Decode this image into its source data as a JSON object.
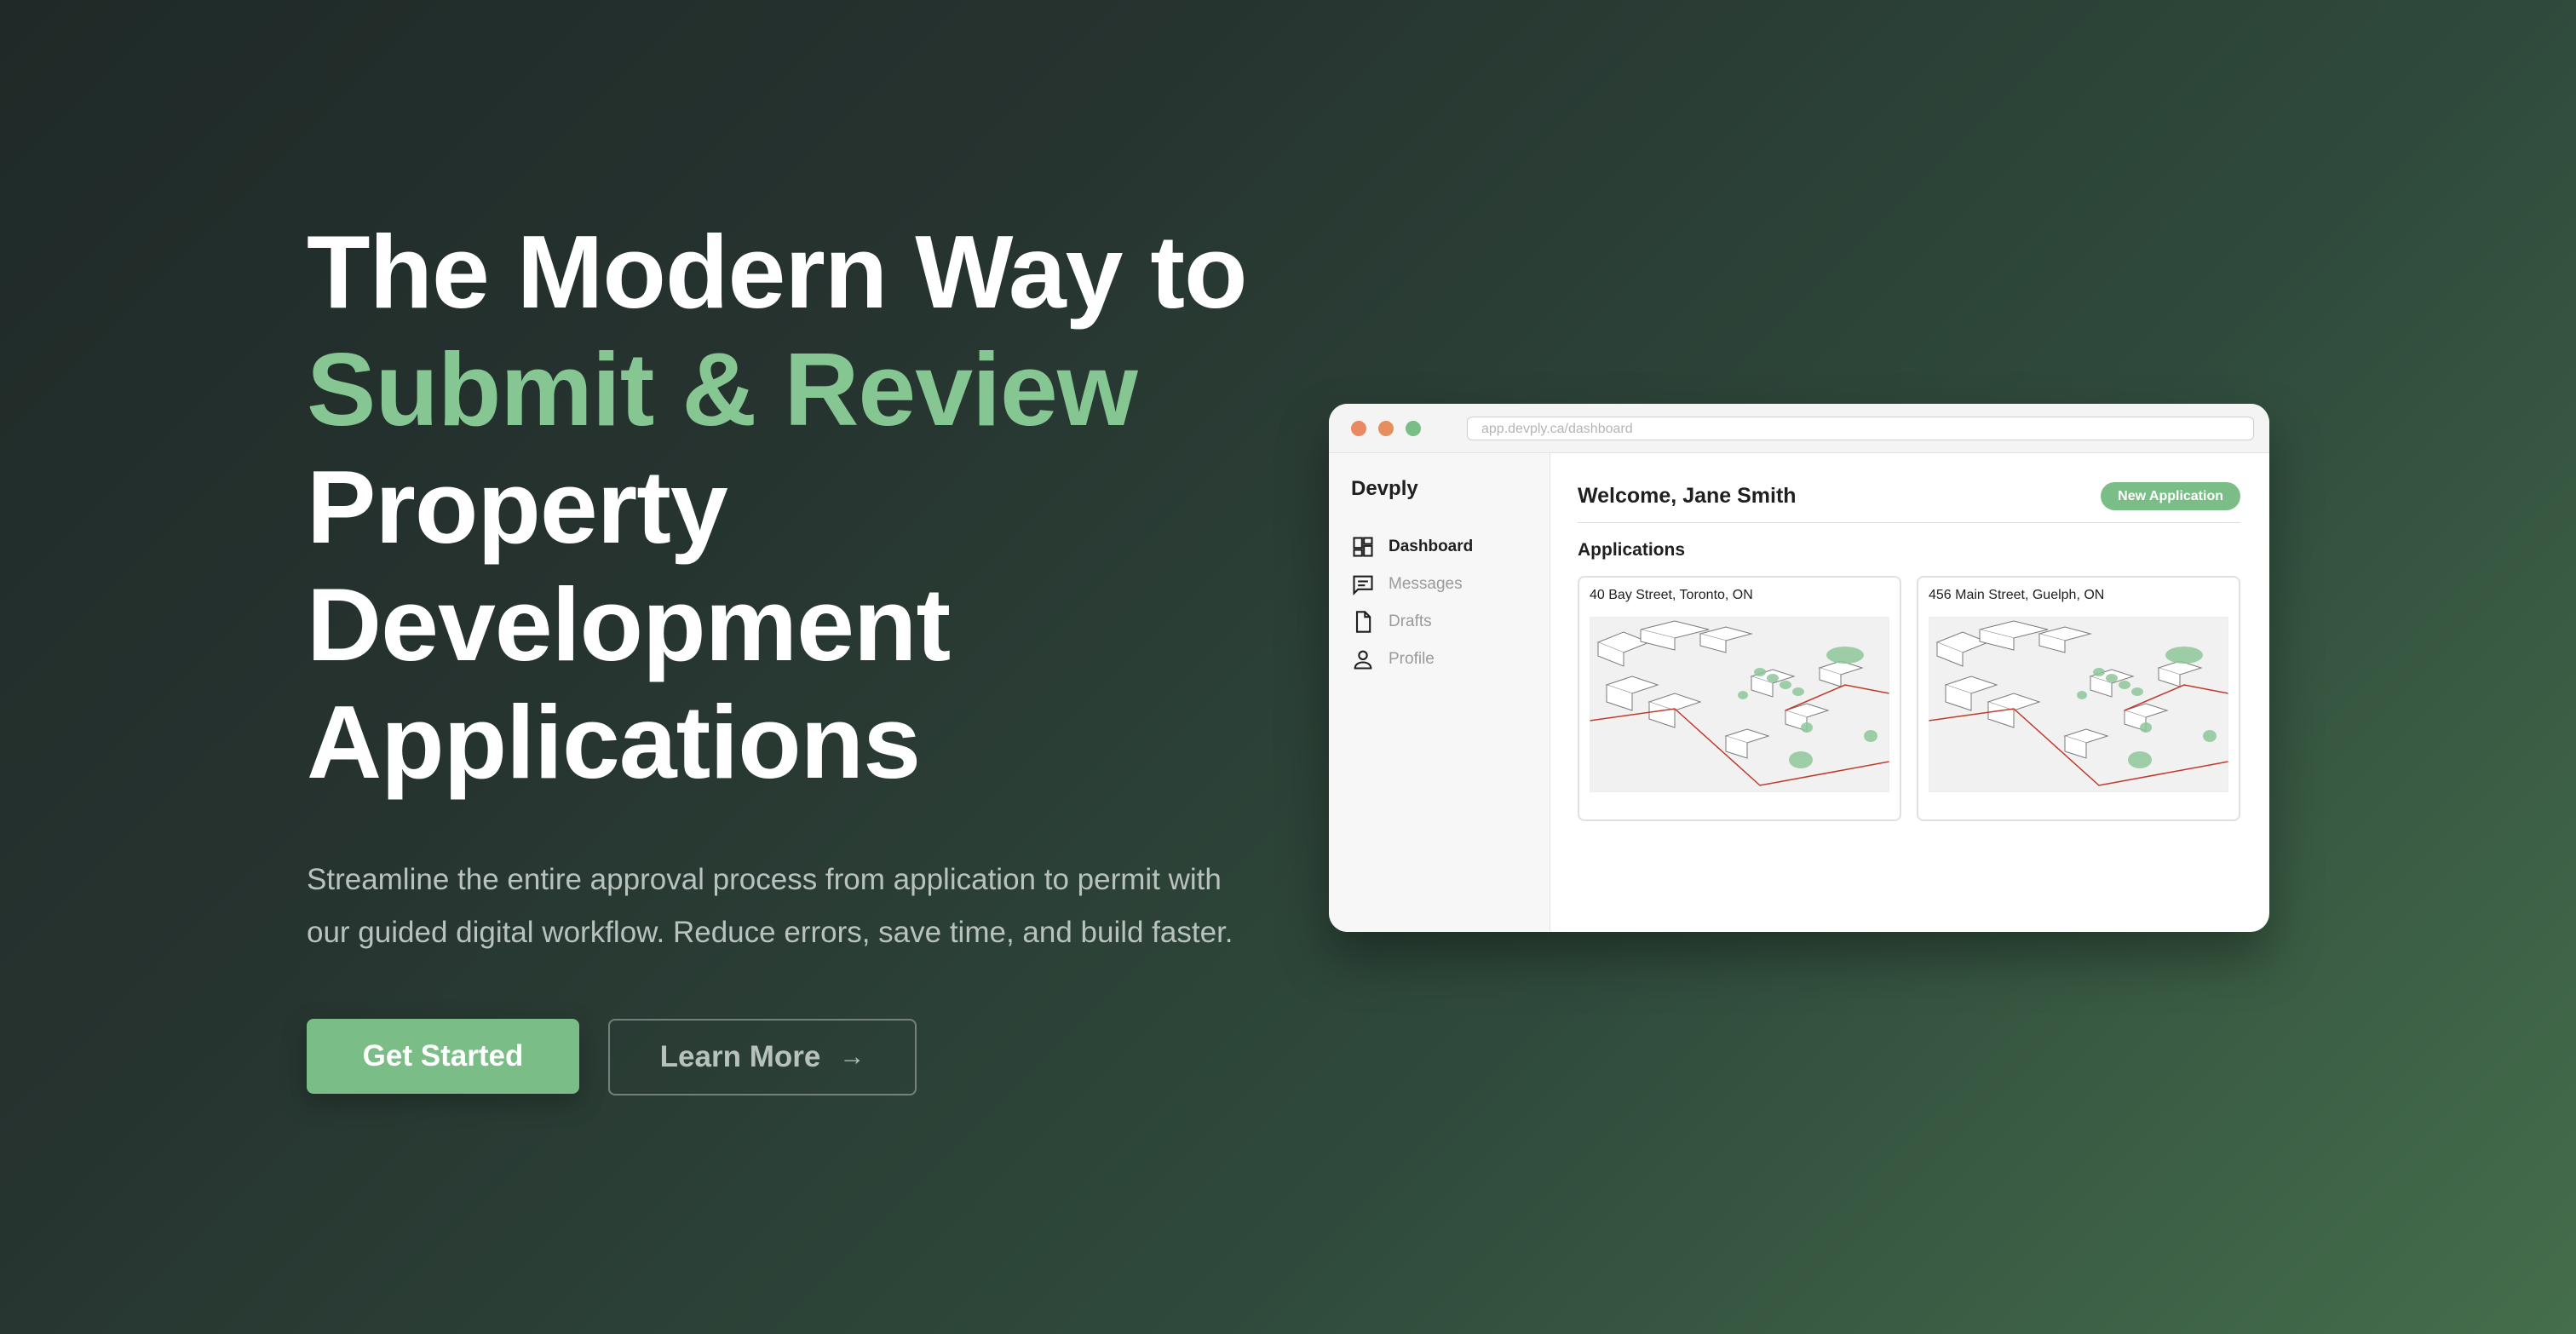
{
  "hero": {
    "headline_line1": "The Modern Way to",
    "headline_accent": "Submit & Review",
    "headline_line3": "Property",
    "headline_line4": "Development",
    "headline_line5": "Applications",
    "subtext": "Streamline the entire approval process from application to permit with our guided digital workflow. Reduce errors, save time, and build faster.",
    "primary_cta": "Get Started",
    "secondary_cta": "Learn More",
    "secondary_cta_icon": "arrow-right-icon"
  },
  "mock": {
    "url": "app.devply.ca/dashboard",
    "window_controls": [
      "close",
      "minimize",
      "maximize"
    ],
    "brand": "Devply",
    "sidebar": {
      "items": [
        {
          "label": "Dashboard",
          "icon": "dashboard-icon",
          "active": true
        },
        {
          "label": "Messages",
          "icon": "messages-icon",
          "active": false
        },
        {
          "label": "Drafts",
          "icon": "document-icon",
          "active": false
        },
        {
          "label": "Profile",
          "icon": "user-icon",
          "active": false
        }
      ]
    },
    "welcome": "Welcome, Jane Smith",
    "new_application": "New Application",
    "section_title": "Applications",
    "applications": [
      {
        "address": "40 Bay Street, Toronto, ON"
      },
      {
        "address": "456 Main Street, Guelph, ON"
      }
    ]
  },
  "colors": {
    "accent_green": "#7bbd86",
    "headline_accent": "#86c693",
    "dot_red": "#e88962",
    "dot_orange": "#e48f5d",
    "plot_boundary": "#c0392b"
  }
}
